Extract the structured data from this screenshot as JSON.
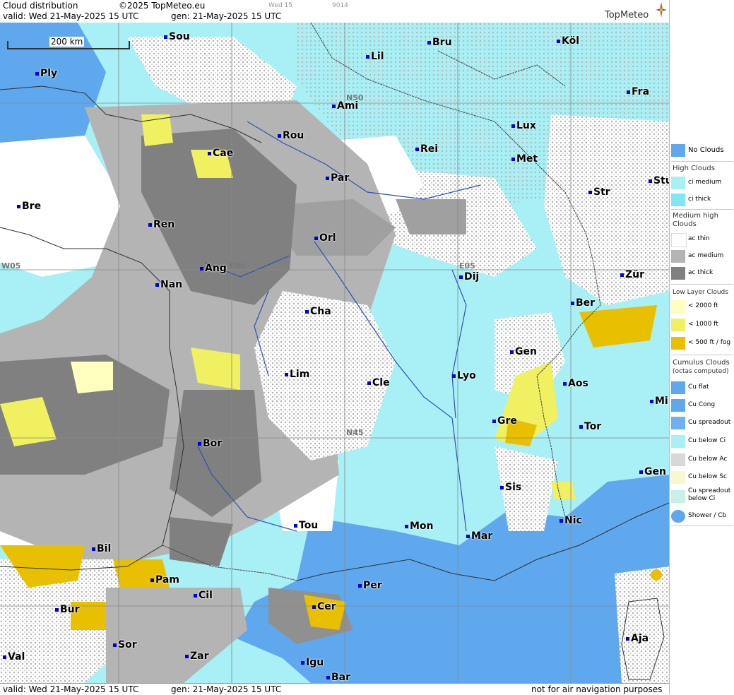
{
  "header": {
    "title": "Cloud distribution",
    "copyright": "©2025 TopMeteo.eu",
    "valid_line": "valid:  Wed  21-May-2025  15 UTC",
    "gen_line": "gen: 21-May-2025 15 UTC",
    "mini_label": "Wed 15",
    "mini_code": "9014",
    "brand": "TopMeteo"
  },
  "footer": {
    "valid_line": "valid:  Wed  21-May-2025  15 UTC",
    "gen_line": "gen: 21-May-2025 15 UTC",
    "disclaimer": "not for air navigation purposes"
  },
  "map": {
    "scale_label": "200 km",
    "grid_labels": [
      "N50",
      "N45",
      "W05",
      "E00",
      "E05"
    ],
    "cities": [
      "Sou",
      "Bru",
      "Köl",
      "Ply",
      "Lil",
      "Fra",
      "Ami",
      "Rou",
      "Lux",
      "Cae",
      "Rei",
      "Met",
      "Par",
      "Str",
      "Stu",
      "Bre",
      "Ren",
      "Orl",
      "Ang",
      "Nan",
      "Dij",
      "Zür",
      "Cha",
      "Ber",
      "Gen",
      "Lim",
      "Cle",
      "Lyo",
      "Aos",
      "Mil",
      "Gre",
      "Tor",
      "Bor",
      "Sis",
      "Gen",
      "Nic",
      "Tou",
      "Mon",
      "Mar",
      "Bil",
      "Pam",
      "Cil",
      "Per",
      "Cer",
      "Bur",
      "Sor",
      "Val",
      "Zar",
      "Igu",
      "Bar",
      "Aja"
    ]
  },
  "legend": {
    "no_clouds": "No Clouds",
    "high_title": "High Clouds",
    "high_items": [
      "ci medium",
      "ci thick"
    ],
    "medium_title": "Medium high Clouds",
    "medium_items": [
      "ac thin",
      "ac medium",
      "ac thick"
    ],
    "low_title": "Low Layer Clouds",
    "low_items": [
      "< 2000 ft",
      "< 1000 ft",
      "< 500 ft / fog"
    ],
    "cu_title": "Cumulus Clouds",
    "cu_subtitle": "(octas computed)",
    "cu_items": [
      "Cu flat",
      "Cu Cong",
      "Cu spreadout",
      "Cu below Ci",
      "Cu below Ac",
      "Cu below Sc",
      "Cu spreadout below Ci",
      "Shower / Cb"
    ],
    "colors": {
      "no_clouds": "#5fa8ee",
      "ci_medium": "#a8f0f5",
      "ci_thick": "#7fe6f2",
      "ac_thin": "#ffffff",
      "ac_medium": "#b4b4b4",
      "ac_thick": "#808080",
      "low_2000": "#ffffc0",
      "low_1000": "#f0f060",
      "low_500": "#e8c000"
    }
  }
}
